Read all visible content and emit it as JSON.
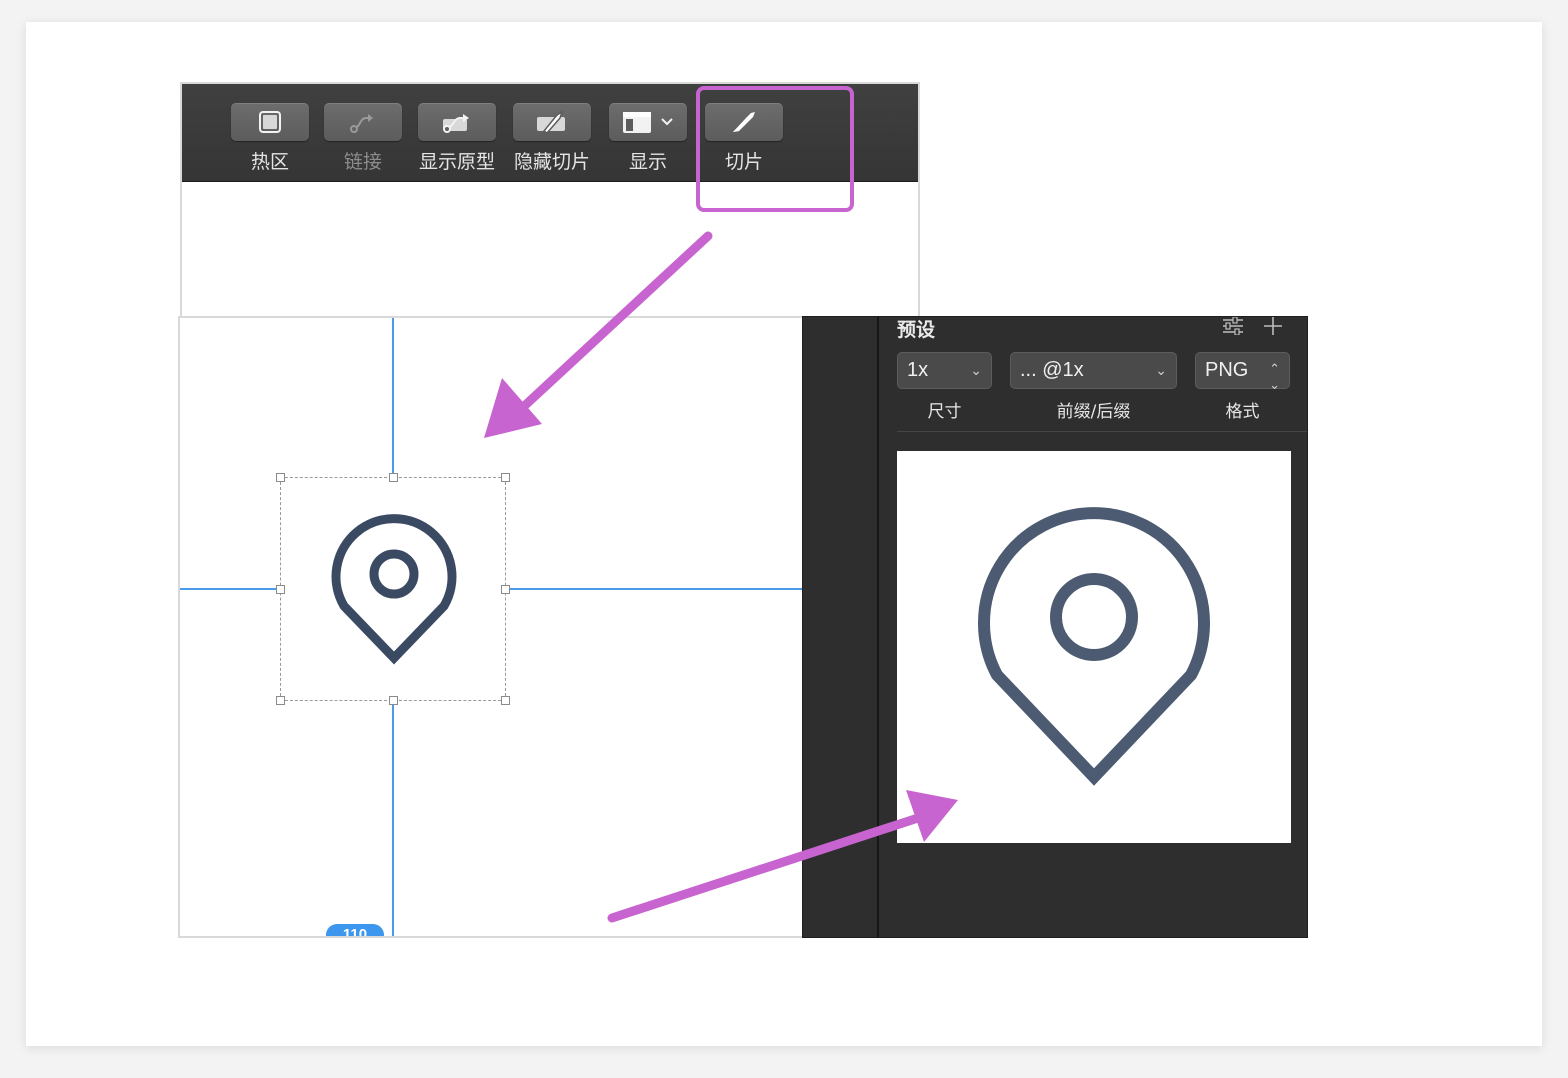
{
  "toolbar": {
    "items": [
      {
        "label": "热区",
        "icon": "hotspot-icon"
      },
      {
        "label": "链接",
        "icon": "link-icon",
        "disabled": true
      },
      {
        "label": "显示原型",
        "icon": "prototype-icon"
      },
      {
        "label": "隐藏切片",
        "icon": "hide-slice-icon"
      },
      {
        "label": "显示",
        "icon": "view-icon"
      },
      {
        "label": "切片",
        "icon": "slice-knife-icon"
      }
    ]
  },
  "canvas": {
    "measure_badge": "110"
  },
  "export_panel": {
    "title": "预设",
    "size": {
      "value": "1x",
      "label": "尺寸"
    },
    "suffix": {
      "value": "... @1x",
      "label": "前缀/后缀"
    },
    "format": {
      "value": "PNG",
      "label": "格式"
    }
  },
  "colors": {
    "highlight": "#c864cf",
    "guide": "#4a9be8",
    "icon_stroke": "#3a4a63"
  }
}
